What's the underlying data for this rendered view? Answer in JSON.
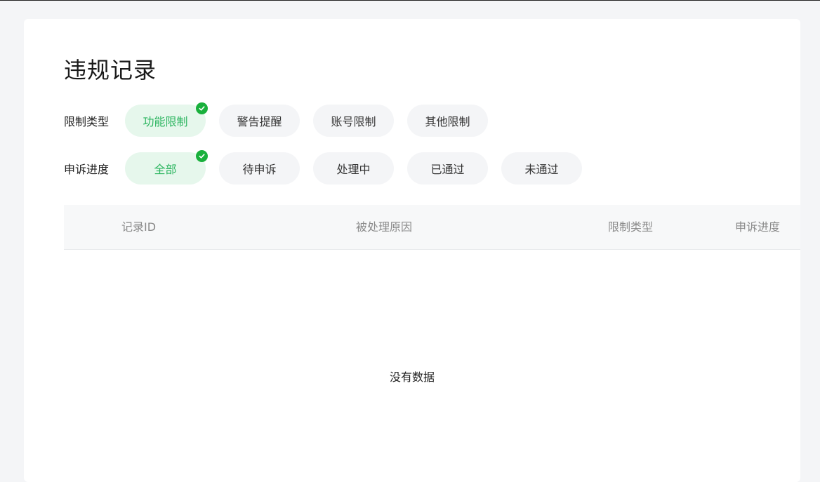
{
  "page": {
    "title": "违规记录"
  },
  "filters": {
    "restriction_type": {
      "label": "限制类型",
      "options": [
        {
          "label": "功能限制",
          "selected": true
        },
        {
          "label": "警告提醒",
          "selected": false
        },
        {
          "label": "账号限制",
          "selected": false
        },
        {
          "label": "其他限制",
          "selected": false
        }
      ]
    },
    "appeal_progress": {
      "label": "申诉进度",
      "options": [
        {
          "label": "全部",
          "selected": true
        },
        {
          "label": "待申诉",
          "selected": false
        },
        {
          "label": "处理中",
          "selected": false
        },
        {
          "label": "已通过",
          "selected": false
        },
        {
          "label": "未通过",
          "selected": false
        }
      ]
    }
  },
  "table": {
    "columns": [
      "记录ID",
      "被处理原因",
      "限制类型",
      "申诉进度"
    ],
    "rows": [],
    "empty_text": "没有数据"
  },
  "colors": {
    "accent": "#19b03c",
    "accent_text": "#2bb55f",
    "selected_bg": "#e6f7ec",
    "chip_bg": "#f4f5f7"
  }
}
